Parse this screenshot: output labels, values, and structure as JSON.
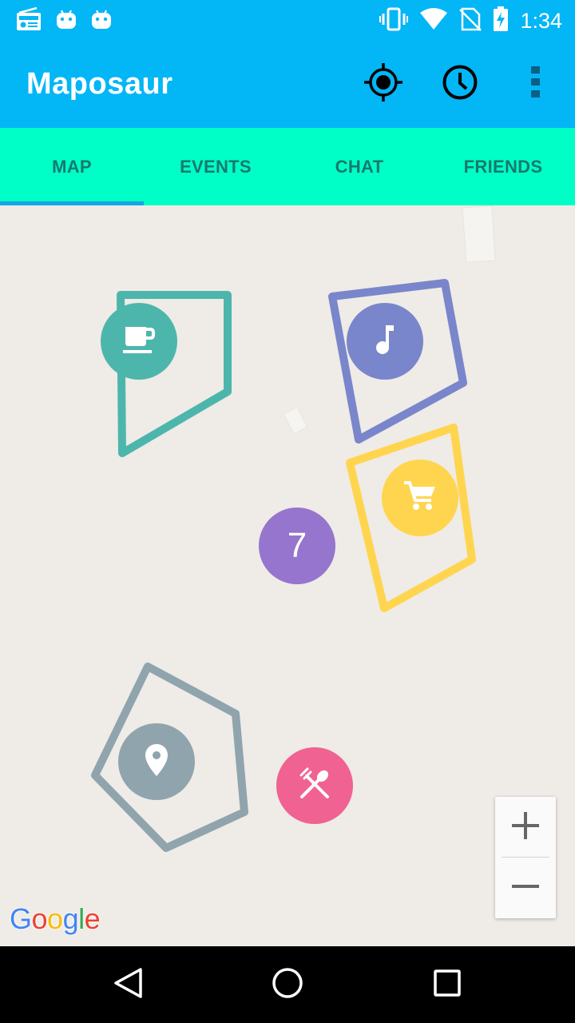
{
  "status_bar": {
    "time": "1:34",
    "left_icons": [
      "radio-icon",
      "android-icon",
      "android-icon"
    ],
    "right_icons": [
      "vibrate-icon",
      "wifi-icon",
      "no-sim-icon",
      "battery-charging-icon"
    ]
  },
  "app_bar": {
    "title": "Maposaur",
    "actions": [
      "my-location-icon",
      "history-clock-icon",
      "overflow-menu-icon"
    ]
  },
  "tabs": [
    {
      "label": "MAP",
      "selected": true
    },
    {
      "label": "EVENTS",
      "selected": false
    },
    {
      "label": "CHAT",
      "selected": false
    },
    {
      "label": "FRIENDS",
      "selected": false
    }
  ],
  "map": {
    "markers": [
      {
        "type": "cafe",
        "icon": "coffee-cup-icon",
        "color": "#4db6ac"
      },
      {
        "type": "music",
        "icon": "music-note-icon",
        "color": "#7986cb"
      },
      {
        "type": "shopping",
        "icon": "shopping-cart-icon",
        "color": "#ffd54f"
      },
      {
        "type": "cluster",
        "count": "7",
        "color": "#9575cd"
      },
      {
        "type": "place",
        "icon": "location-pin-icon",
        "color": "#90a4ae"
      },
      {
        "type": "restaurant",
        "icon": "fork-spoon-icon",
        "color": "#f06292"
      }
    ],
    "zoom": {
      "in_label": "+",
      "out_label": "−"
    },
    "attribution": [
      "G",
      "o",
      "o",
      "g",
      "l",
      "e"
    ]
  },
  "colors": {
    "primary": "#03b6f6",
    "tab_bar": "#00ffc6",
    "tab_text": "#167a6d",
    "tab_indicator": "#14a5e6",
    "map_background": "#efebe6"
  },
  "nav_bar": {
    "buttons": [
      "back-triangle-icon",
      "home-circle-icon",
      "recents-square-icon"
    ]
  }
}
